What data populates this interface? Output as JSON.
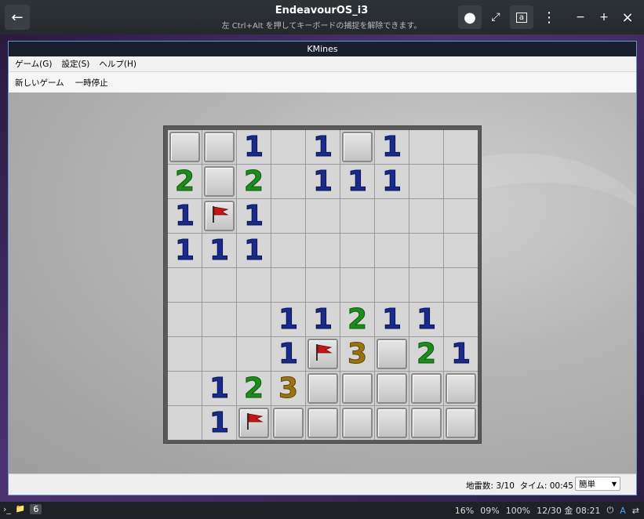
{
  "viewer": {
    "title": "EndeavourOS_i3",
    "subtitle": "左 Ctrl+Alt を押してキーボードの捕捉を解除できます。",
    "back_icon": "←",
    "record_icon": "●",
    "fullscreen_icon": "⤢",
    "keyboard_icon": "a",
    "menu_icon": "⋮",
    "minimize_icon": "−",
    "maximize_icon": "+",
    "close_icon": "×"
  },
  "window": {
    "title": "KMines",
    "menu": [
      "ゲーム(G)",
      "設定(S)",
      "ヘルプ(H)"
    ],
    "toolbar": [
      "新しいゲーム",
      "一時停止"
    ]
  },
  "board": {
    "rows": [
      [
        "C",
        "C",
        "1",
        "",
        "1",
        "C",
        "1",
        "",
        ""
      ],
      [
        "2",
        "C",
        "2",
        "",
        "1",
        "1",
        "1",
        "",
        ""
      ],
      [
        "1",
        "F",
        "1",
        "",
        "",
        "",
        "",
        "",
        ""
      ],
      [
        "1",
        "1",
        "1",
        "",
        "",
        "",
        "",
        "",
        ""
      ],
      [
        "",
        "",
        "",
        "",
        "",
        "",
        "",
        "",
        ""
      ],
      [
        "",
        "",
        "",
        "1",
        "1",
        "2",
        "1",
        "1",
        ""
      ],
      [
        "",
        "",
        "",
        "1",
        "F",
        "3",
        "C",
        "2",
        "1"
      ],
      [
        "",
        "1",
        "2",
        "3",
        "C",
        "C",
        "C",
        "C",
        "C"
      ],
      [
        "",
        "1",
        "F",
        "C",
        "C",
        "C",
        "C",
        "C",
        "C"
      ]
    ],
    "flag_icon": "red-flag-icon"
  },
  "status": {
    "text": "地雷数: 3/10  タイム: 00:45",
    "difficulty": "簡単",
    "chevron": "▼"
  },
  "taskbar": {
    "left": [
      "›_",
      "📁"
    ],
    "workspace": "6",
    "cpu": "16%",
    "mem": "09%",
    "volume": "100%",
    "datetime": "12/30 金 08:21",
    "power_icon": "⏻",
    "a_icon": "A",
    "net_icon": "⇄"
  }
}
